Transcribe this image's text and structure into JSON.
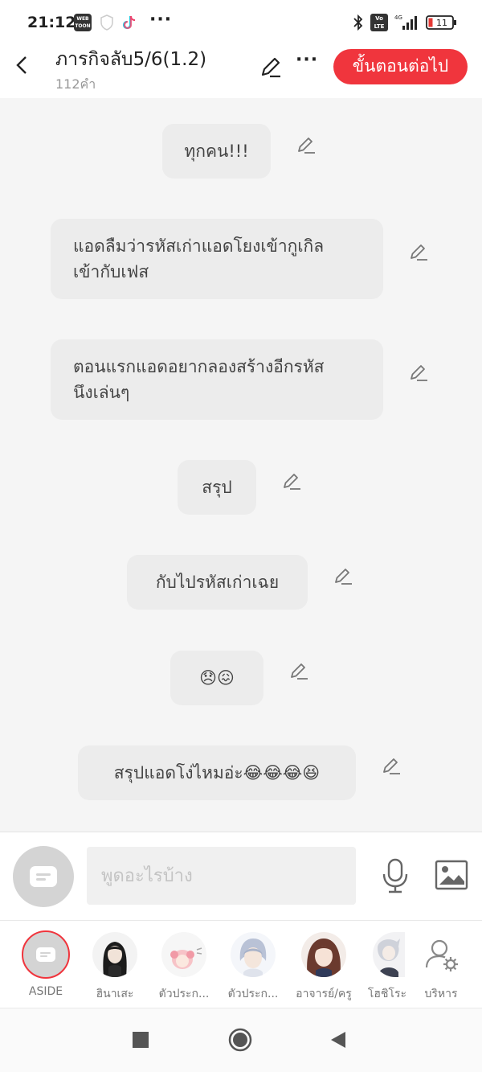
{
  "status_bar": {
    "time": "21:12",
    "webtoon_label": "WEB TOON",
    "volte_label": "Vo LTE",
    "network": "4G",
    "battery": "11"
  },
  "header": {
    "title": "ภารกิจลับ5/6(1.2)",
    "word_count": "112คำ",
    "next_button": "ขั้นตอนต่อไป"
  },
  "messages": [
    {
      "text": "ทุกคน!!!"
    },
    {
      "text": "แอดลืมว่ารหัสเก่าแอดโยงเข้ากูเกิล\nเข้ากับเฟส"
    },
    {
      "text": "ตอนแรกแอดอยากลองสร้างอีกรหัส\nนึงเล่นๆ"
    },
    {
      "text": "สรุป"
    },
    {
      "text": "กับไปรหัสเก่าเฉย"
    },
    {
      "text": "😞😖"
    },
    {
      "text": "สรุปแอดโง่ไหมอ่ะ😂😂😂😆"
    }
  ],
  "input": {
    "placeholder": "พูดอะไรบ้าง",
    "value": ""
  },
  "characters": [
    {
      "label": "ASIDE"
    },
    {
      "label": "ฮินาเสะ"
    },
    {
      "label": "ตัวประก..."
    },
    {
      "label": "ตัวประก..."
    },
    {
      "label": "อาจารย์/ครู"
    },
    {
      "label": "โฮชิโระ"
    },
    {
      "label": "บริหาร"
    }
  ],
  "colors": {
    "accent": "#f0353d",
    "bubble": "#ececec",
    "background": "#f5f5f5"
  },
  "icons": [
    "back-icon",
    "edit-icon",
    "more-icon",
    "chat-icon",
    "mic-icon",
    "image-icon",
    "manage-characters-icon"
  ]
}
